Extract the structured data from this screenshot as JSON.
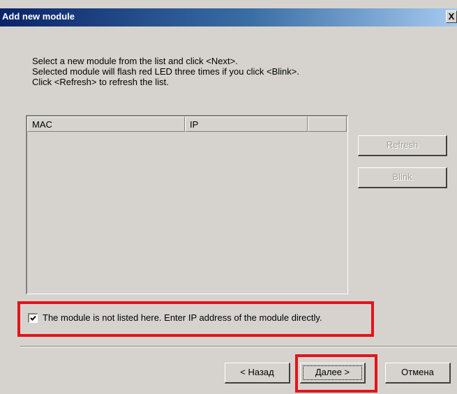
{
  "window": {
    "title": "Add new module",
    "close_label": "X"
  },
  "instructions": {
    "line1": "Select a new module from the list and click <Next>.",
    "line2": "Selected module will flash red LED three times if you click <Blink>.",
    "line3": "Click <Refresh> to refresh the list."
  },
  "module_list": {
    "columns": [
      "MAC",
      "IP",
      ""
    ],
    "rows": []
  },
  "side_buttons": {
    "refresh_label": "Refresh",
    "blink_label": "Blink"
  },
  "manual_entry": {
    "checked": true,
    "label": "The module is not listed here. Enter IP address of the module directly."
  },
  "footer": {
    "back_label": "< Назад",
    "next_label": "Далее >",
    "cancel_label": "Отмена"
  },
  "colors": {
    "highlight": "#e2141d",
    "titlebar_start": "#0a246a",
    "titlebar_end": "#a6caf0",
    "face": "#d6d3ce"
  },
  "icons": {
    "close": "close-icon",
    "check": "checkmark-icon"
  }
}
